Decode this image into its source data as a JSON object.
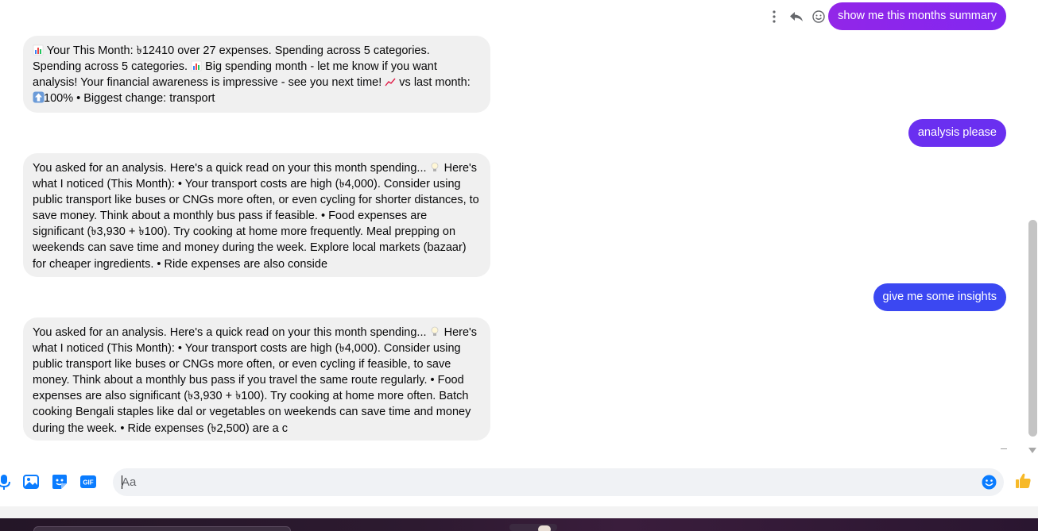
{
  "chat": {
    "outgoing": [
      {
        "text": "show me this months summary",
        "color": "#8a2be2"
      },
      {
        "text": "analysis please",
        "color": "#6a2ff0"
      },
      {
        "text": "give me some insights",
        "color": "#3b48f2"
      }
    ],
    "incoming": [
      {
        "parts": [
          "Your This Month: ৳12410 over 27 expenses. Spending across 5 categories. Spending across 5 categories.",
          "Big spending month - let me know if you want analysis! Your financial awareness is impressive - see you next time!",
          "vs last month:",
          "100% • Biggest change: transport"
        ]
      },
      {
        "parts": [
          "You asked for an analysis. Here's a quick read on your this month spending...",
          "Here's what I noticed (This Month): • Your transport costs are high (৳4,000). Consider using public transport like buses or CNGs more often, or even cycling for shorter distances, to save money. Think about a monthly bus pass if feasible. • Food expenses are significant (৳3,930 + ৳100). Try cooking at home more frequently. Meal prepping on weekends can save time and money during the week. Explore local markets (bazaar) for cheaper ingredients. • Ride expenses are also conside"
        ]
      },
      {
        "parts": [
          "You asked for an analysis. Here's a quick read on your this month spending...",
          "Here's what I noticed (This Month): • Your transport costs are high (৳4,000). Consider using public transport like buses or CNGs more often, or even cycling if feasible, to save money. Think about a monthly bus pass if you travel the same route regularly. • Food expenses are also significant (৳3,930 + ৳100). Try cooking at home more often. Batch cooking Bengali staples like dal or vegetables on weekends can save time and money during the week. • Ride expenses (৳2,500) are a c"
        ]
      }
    ],
    "icons": {
      "chart": "bar-chart-emoji",
      "trend": "chart-increasing-emoji",
      "up": "up-arrow-emoji",
      "bulb": "light-bulb-emoji"
    }
  },
  "message_actions": [
    "more-options-icon",
    "reply-icon",
    "react-icon"
  ],
  "composer": {
    "placeholder": "Aa",
    "tools": [
      "microphone-icon",
      "image-icon",
      "sticker-icon",
      "gif-icon"
    ],
    "gif_label": "GIF",
    "accent": "#0a7cff",
    "like_icon": "thumbs-up-icon"
  }
}
